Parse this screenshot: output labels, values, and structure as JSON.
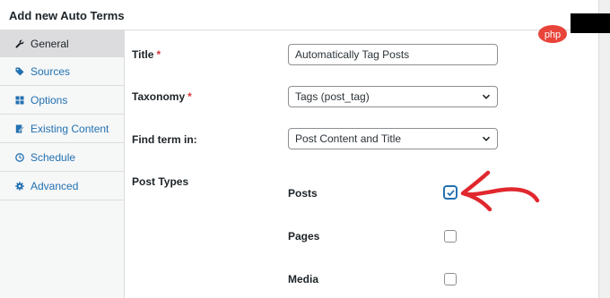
{
  "panel": {
    "title": "Add new Auto Terms"
  },
  "sidebar": {
    "items": [
      {
        "label": "General",
        "icon": "wrench-icon",
        "active": true
      },
      {
        "label": "Sources",
        "icon": "tag-icon",
        "active": false
      },
      {
        "label": "Options",
        "icon": "grid-icon",
        "active": false
      },
      {
        "label": "Existing Content",
        "icon": "document-edit-icon",
        "active": false
      },
      {
        "label": "Schedule",
        "icon": "clock-icon",
        "active": false
      },
      {
        "label": "Advanced",
        "icon": "gear-icon",
        "active": false
      }
    ]
  },
  "form": {
    "title_label": "Title",
    "title_required": "*",
    "title_value": "Automatically Tag Posts",
    "taxonomy_label": "Taxonomy",
    "taxonomy_required": "*",
    "taxonomy_value": "Tags (post_tag)",
    "find_term_label": "Find term in:",
    "find_term_value": "Post Content and Title",
    "post_types_label": "Post Types",
    "post_types": [
      {
        "label": "Posts",
        "checked": true
      },
      {
        "label": "Pages",
        "checked": false
      },
      {
        "label": "Media",
        "checked": false
      }
    ]
  },
  "overlay": {
    "badge_text": "php",
    "badge_color": "#e8443a",
    "arrow_color": "#e0282e"
  },
  "colors": {
    "link": "#2271b1",
    "required": "#d63638"
  }
}
